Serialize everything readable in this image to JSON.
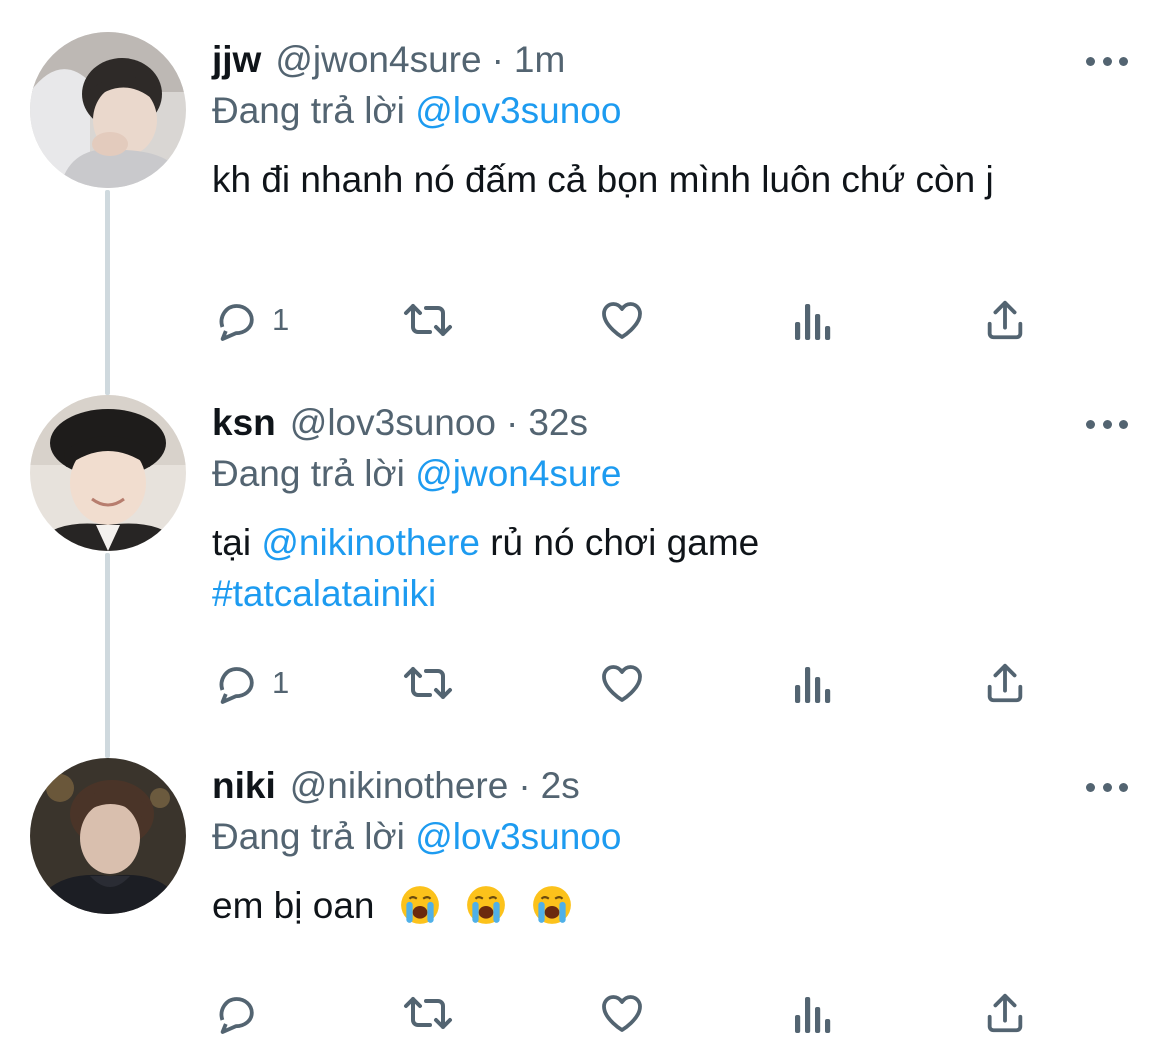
{
  "tweets": [
    {
      "name": "jjw",
      "handle": "@jwon4sure",
      "time": "1m",
      "reply_prefix": "Đang trả lời",
      "reply_to": "@lov3sunoo",
      "text": "kh đi nhanh nó đấm cả bọn mình luôn chứ còn j",
      "reply_count": "1",
      "avatar_icon": "profile-photo-jjw"
    },
    {
      "name": "ksn",
      "handle": "@lov3sunoo",
      "time": "32s",
      "reply_prefix": "Đang trả lời",
      "reply_to": "@jwon4sure",
      "text_pre": "tại",
      "mention": "@nikinothere",
      "text_post": "rủ nó chơi game",
      "hashtag": "#tatcalatainiki",
      "reply_count": "1",
      "avatar_icon": "profile-photo-ksn"
    },
    {
      "name": "niki",
      "handle": "@nikinothere",
      "time": "2s",
      "reply_prefix": "Đang trả lời",
      "reply_to": "@lov3sunoo",
      "text": "em bị oan",
      "emoji_icon": "loudly-crying-face-icon",
      "reply_count": "",
      "avatar_icon": "profile-photo-niki"
    }
  ],
  "separator": "·",
  "colors": {
    "text": "#0f1419",
    "secondary": "#536471",
    "link": "#1d9bf0",
    "thread_line": "#cfd9de"
  },
  "icons": [
    "reply-icon",
    "retweet-icon",
    "like-icon",
    "views-icon",
    "share-icon",
    "more-icon"
  ]
}
